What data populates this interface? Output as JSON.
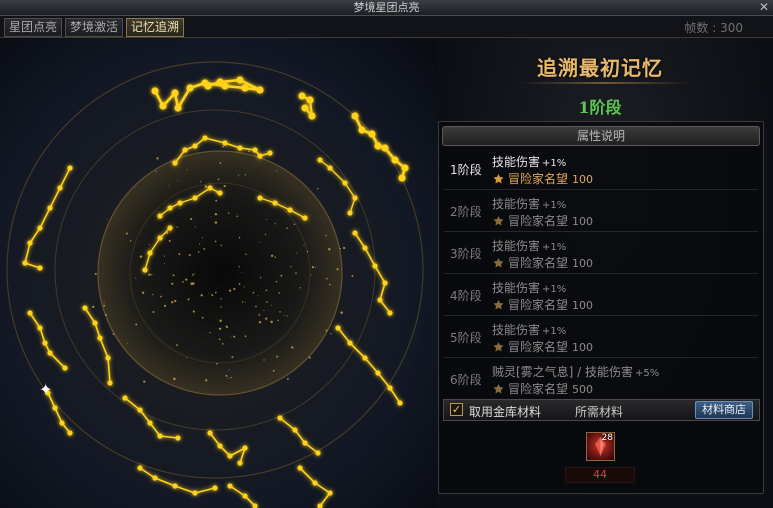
{
  "window": {
    "title": "梦境星团点亮",
    "close_glyph": "✕"
  },
  "tabs": [
    {
      "label": "星团点亮",
      "active": false
    },
    {
      "label": "梦境激活",
      "active": false
    },
    {
      "label": "记忆追溯",
      "active": true
    }
  ],
  "fps": "帧数 : 300",
  "memory": {
    "title": "追溯最初记忆",
    "stage": "1阶段"
  },
  "panel": {
    "header": "属性说明",
    "stages": [
      {
        "label": "1阶段",
        "skill": "技能伤害",
        "bonus": "+1%",
        "reputation": "冒险家名望",
        "rep_value": "100",
        "active": true
      },
      {
        "label": "2阶段",
        "skill": "技能伤害",
        "bonus": "+1%",
        "reputation": "冒险家名望",
        "rep_value": "100",
        "active": false
      },
      {
        "label": "3阶段",
        "skill": "技能伤害",
        "bonus": "+1%",
        "reputation": "冒险家名望",
        "rep_value": "100",
        "active": false
      },
      {
        "label": "4阶段",
        "skill": "技能伤害",
        "bonus": "+1%",
        "reputation": "冒险家名望",
        "rep_value": "100",
        "active": false
      },
      {
        "label": "5阶段",
        "skill": "技能伤害",
        "bonus": "+1%",
        "reputation": "冒险家名望",
        "rep_value": "100",
        "active": false
      },
      {
        "label": "6阶段",
        "skill": "贼灵[雾之气息] / 技能伤害",
        "bonus": "+5%",
        "reputation": "冒险家名望",
        "rep_value": "500",
        "active": false
      }
    ]
  },
  "materials": {
    "use_storage_label": "取用金库材料",
    "use_storage_checked": true,
    "check_glyph": "✓",
    "required_label": "所需材料",
    "shop_button": "材料商店",
    "item_count": "28",
    "item_quantity": "44"
  },
  "colors": {
    "title_gold": "#e8b96a",
    "stage_green": "#5bc84e",
    "constellation_gold": "#ffd21a",
    "required_red": "#e23b3b"
  },
  "icons": {
    "close": "close-icon",
    "reputation": "reputation-emblem-icon",
    "checkbox": "checkmark-icon",
    "item": "material-item-icon"
  }
}
